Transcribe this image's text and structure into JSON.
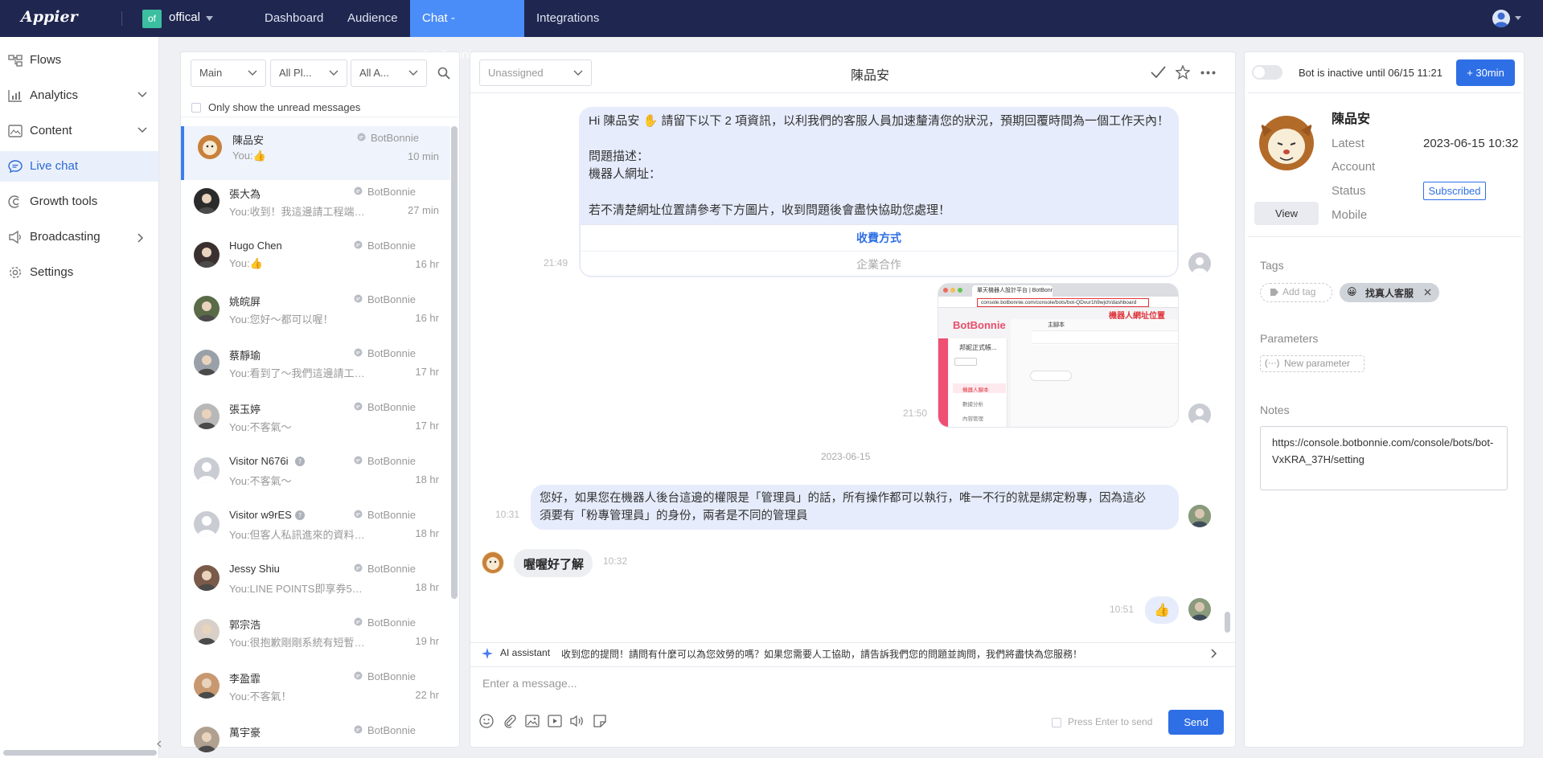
{
  "topbar": {
    "logo": "Appier",
    "account_badge": "of",
    "account_name": "offical",
    "nav": [
      "Dashboard",
      "Audience",
      "Chat - BotBonnie",
      "Integrations"
    ]
  },
  "sidebar": {
    "items": [
      {
        "label": "Flows",
        "icon": "flows-icon"
      },
      {
        "label": "Analytics",
        "icon": "analytics-icon"
      },
      {
        "label": "Content",
        "icon": "content-icon"
      },
      {
        "label": "Live chat",
        "icon": "live-chat-icon"
      },
      {
        "label": "Growth tools",
        "icon": "growth-tools-icon"
      },
      {
        "label": "Broadcasting",
        "icon": "broadcasting-icon"
      },
      {
        "label": "Settings",
        "icon": "settings-icon"
      }
    ]
  },
  "conversations": {
    "filters": {
      "main": "Main",
      "platform": "All Pl...",
      "assignee": "All A..."
    },
    "unread_label": "Only show the unread messages",
    "items": [
      {
        "name": "陳品安",
        "message": "You:👍",
        "source": "BotBonnie",
        "time": "10 min"
      },
      {
        "name": "張大為",
        "message": "You:收到！我這邊請工程端協...",
        "source": "BotBonnie",
        "time": "27 min"
      },
      {
        "name": "Hugo Chen",
        "message": "You:👍",
        "source": "BotBonnie",
        "time": "16 hr"
      },
      {
        "name": "姚皖屏",
        "message": "You:您好～都可以喔！",
        "source": "BotBonnie",
        "time": "16 hr"
      },
      {
        "name": "蔡靜瑜",
        "message": "You:看到了～我們這邊請工程...",
        "source": "BotBonnie",
        "time": "17 hr"
      },
      {
        "name": "張玉婷",
        "message": "You:不客氣～",
        "source": "BotBonnie",
        "time": "17 hr"
      },
      {
        "name": "Visitor N676i",
        "message": "You:不客氣～",
        "source": "BotBonnie",
        "time": "18 hr"
      },
      {
        "name": "Visitor w9rES",
        "message": "You:但客人私訊進來的資料當...",
        "source": "BotBonnie",
        "time": "18 hr"
      },
      {
        "name": "Jessy Shiu",
        "message": "You:LINE POINTS即享券50點...",
        "source": "BotBonnie",
        "time": "18 hr"
      },
      {
        "name": "郭宗浩",
        "message": "You:很抱歉剛剛系統有短暫的...",
        "source": "BotBonnie",
        "time": "19 hr"
      },
      {
        "name": "李盈霏",
        "message": "You:不客氣！",
        "source": "BotBonnie",
        "time": "22 hr"
      },
      {
        "name": "萬宇豪",
        "message": "",
        "source": "BotBonnie",
        "time": ""
      }
    ]
  },
  "chat": {
    "assign": "Unassigned",
    "title": "陳品安",
    "msg1": {
      "line1": "Hi 陳品安 ✋ 請留下以下 2 項資訊，以利我們的客服人員加速釐清您的狀況，預期回覆時間為一個工作天內！",
      "line2": "問題描述：",
      "line3": "機器人網址：",
      "line4": "若不清楚網址位置請參考下方圖片，收到問題後會盡快協助您處理！",
      "btn1": "收費方式",
      "btn2": "企業合作",
      "time": "21:49"
    },
    "image_msg": {
      "time": "21:50",
      "tab": "單天機器人設計平台 | BotBonnie",
      "url": "console.botbonnie.com/console/bots/bot-QDvur1h9wjch/dashboard",
      "highlight": "機器人網址位置",
      "brand": "BotBonnie",
      "side1": "邦妮正式帳...",
      "side2": "機器人腳本",
      "side3": "數據分析",
      "side4": "內容管理",
      "tab_label": "主腳本"
    },
    "date_divider": "2023-06-15",
    "msg2": {
      "line1": "您好，如果您在機器人後台這邊的權限是「管理員」的話，所有操作都可以執行，唯一不行的就是綁定粉專，因為這必",
      "line2": "須要有「粉專管理員」的身份，兩者是不同的管理員",
      "time": "10:31"
    },
    "msg3": {
      "text": "喔喔好了解",
      "time": "10:32"
    },
    "msg4": {
      "text": "👍",
      "time": "10:51"
    },
    "ai_label": "AI assistant",
    "ai_text": "收到您的提問！請問有什麼可以為您效勞的嗎？如果您需要人工協助，請告訴我們您的問題並詢問，我們將盡快為您服務！",
    "input_placeholder": "Enter a message...",
    "enter_label": "Press Enter to send",
    "send": "Send"
  },
  "profile": {
    "bot_status": "Bot is inactive until 06/15 11:21",
    "plus_btn": "+ 30min",
    "name": "陳品安",
    "view": "View",
    "latest_label": "Latest",
    "latest_value": "2023-06-15 10:32",
    "account_label": "Account",
    "status_label": "Status",
    "status_value": "Subscribed",
    "mobile_label": "Mobile",
    "tags_title": "Tags",
    "add_tag": "Add tag",
    "tag1": "找真人客服",
    "params_title": "Parameters",
    "new_param": "New parameter",
    "notes_title": "Notes",
    "notes_value": "https://console.botbonnie.com/console/bots/bot-VxKRA_37H/setting"
  },
  "colors": {
    "topbar": "#1f2650",
    "accent": "#2f6fe6",
    "active_nav": "#4b8df8"
  }
}
